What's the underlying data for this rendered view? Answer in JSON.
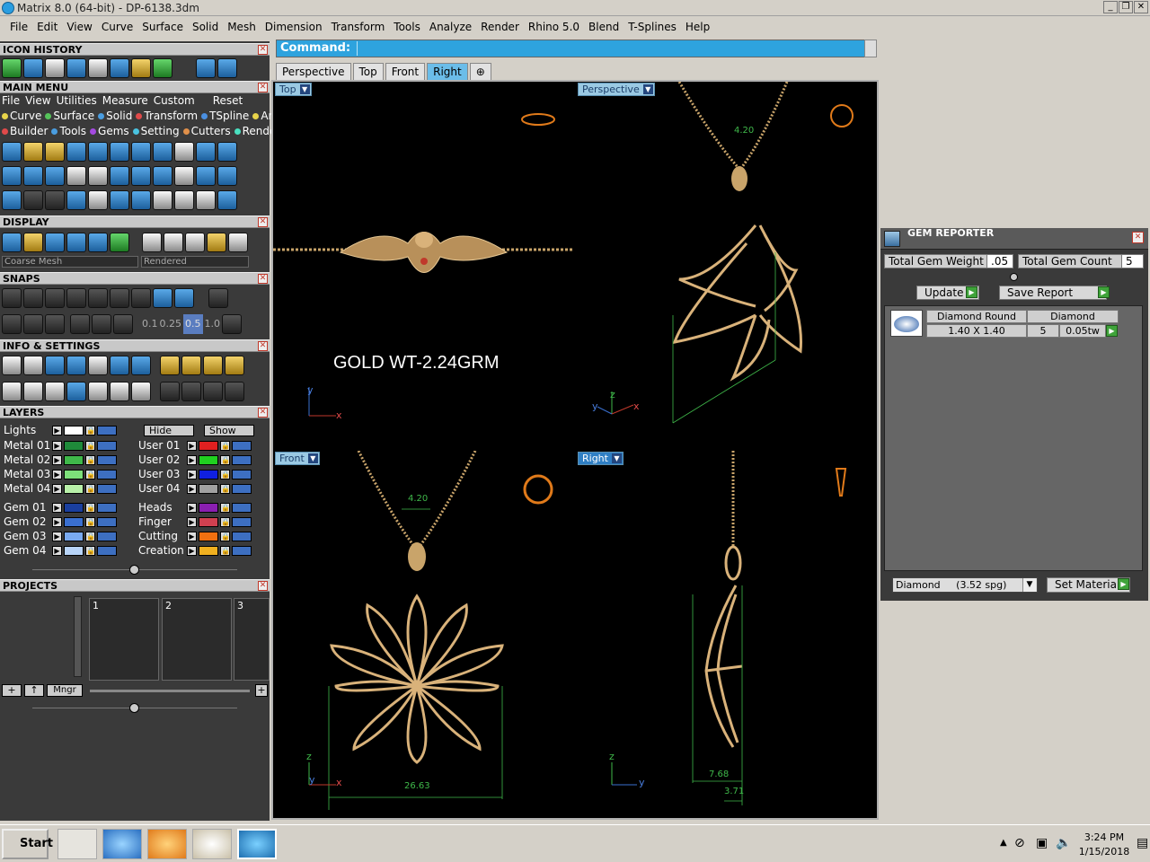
{
  "window": {
    "title": "Matrix 8.0 (64-bit) - DP-6138.3dm",
    "controls": [
      "_",
      "❐",
      "✕"
    ]
  },
  "menubar": [
    "File",
    "Edit",
    "View",
    "Curve",
    "Surface",
    "Solid",
    "Mesh",
    "Dimension",
    "Transform",
    "Tools",
    "Analyze",
    "Render",
    "Rhino 5.0",
    "Blend",
    "T-Splines",
    "Help"
  ],
  "left": {
    "icon_history": "ICON HISTORY",
    "main_menu": {
      "title": "MAIN MENU",
      "items": [
        "File",
        "View",
        "Utilities",
        "Measure",
        "Custom"
      ],
      "reset": "Reset",
      "row1": [
        "Curve",
        "Surface",
        "Solid",
        "Transform",
        "TSpline",
        "Art"
      ],
      "row1_colors": [
        "#e8d44a",
        "#55c35a",
        "#4a9de0",
        "#e04a4a",
        "#4a8fe0",
        "#e8d44a"
      ],
      "row2": [
        "Builder",
        "Tools",
        "Gems",
        "Setting",
        "Cutters",
        "Render"
      ],
      "row2_colors": [
        "#e04a4a",
        "#4a9de0",
        "#a44ae0",
        "#4ac3e0",
        "#e0904a",
        "#4ae0c0"
      ]
    },
    "display": {
      "title": "DISPLAY",
      "mesh_select": "Coarse Mesh",
      "render_select": "Rendered"
    },
    "snaps": {
      "title": "SNAPS",
      "values": [
        "0.1",
        "0.25",
        "0.5",
        "1.0"
      ]
    },
    "info": {
      "title": "INFO & SETTINGS"
    },
    "layers": {
      "title": "LAYERS",
      "lights": "Lights",
      "hide": "Hide",
      "show": "Show",
      "left_col": [
        {
          "name": "Metal 01",
          "color": "#1f8a3a"
        },
        {
          "name": "Metal 02",
          "color": "#3fb84a"
        },
        {
          "name": "Metal 03",
          "color": "#7de07a"
        },
        {
          "name": "Metal 04",
          "color": "#b8f0a8"
        },
        {
          "name": "Gem 01",
          "color": "#1a3f9e"
        },
        {
          "name": "Gem 02",
          "color": "#3a6fcf"
        },
        {
          "name": "Gem 03",
          "color": "#7aaaf0"
        },
        {
          "name": "Gem 04",
          "color": "#b8d4f8"
        }
      ],
      "right_col": [
        {
          "name": "User 01",
          "color": "#e02020"
        },
        {
          "name": "User 02",
          "color": "#20d020"
        },
        {
          "name": "User 03",
          "color": "#1020e0"
        },
        {
          "name": "User 04",
          "color": "#a0a0a0"
        },
        {
          "name": "Heads",
          "color": "#8a1fb0"
        },
        {
          "name": "Finger",
          "color": "#d04050"
        },
        {
          "name": "Cutting",
          "color": "#f07010"
        },
        {
          "name": "Creation",
          "color": "#f0b020"
        }
      ]
    },
    "projects": {
      "title": "PROJECTS",
      "slots": [
        "1",
        "2",
        "3"
      ],
      "mngr": "Mngr"
    }
  },
  "command": {
    "label": "Command:"
  },
  "tabs": [
    "Perspective",
    "Top",
    "Front",
    "Right"
  ],
  "tab_add": "⊕",
  "viewports": {
    "top": {
      "label": "Top",
      "annotation": "GOLD WT-2.24GRM",
      "axis_x": "x",
      "axis_y": "y"
    },
    "perspective": {
      "label": "Perspective",
      "dim": "4.20",
      "axis_x": "x",
      "axis_y": "y",
      "axis_z": "z"
    },
    "front": {
      "label": "Front",
      "dim_top": "4.20",
      "dim_bottom": "26.63",
      "axis_x": "x",
      "axis_y": "y",
      "axis_z": "z"
    },
    "right": {
      "label": "Right",
      "dim_a": "7.68",
      "dim_b": "3.71",
      "axis_y": "y",
      "axis_z": "z"
    }
  },
  "gem_reporter": {
    "title": "GEM REPORTER",
    "total_weight_label": "Total Gem Weight",
    "total_weight": ".05",
    "total_count_label": "Total Gem Count",
    "total_count": "5",
    "update": "Update",
    "save_report": "Save Report",
    "row": {
      "name": "Diamond Round",
      "size": "1.40 X 1.40",
      "material": "Diamond",
      "count": "5",
      "tw": "0.05tw"
    },
    "material_select": "Diamond     (3.52 spg)",
    "set_material": "Set Material"
  },
  "taskbar": {
    "start": "Start",
    "time": "3:24 PM",
    "date": "1/15/2018"
  }
}
